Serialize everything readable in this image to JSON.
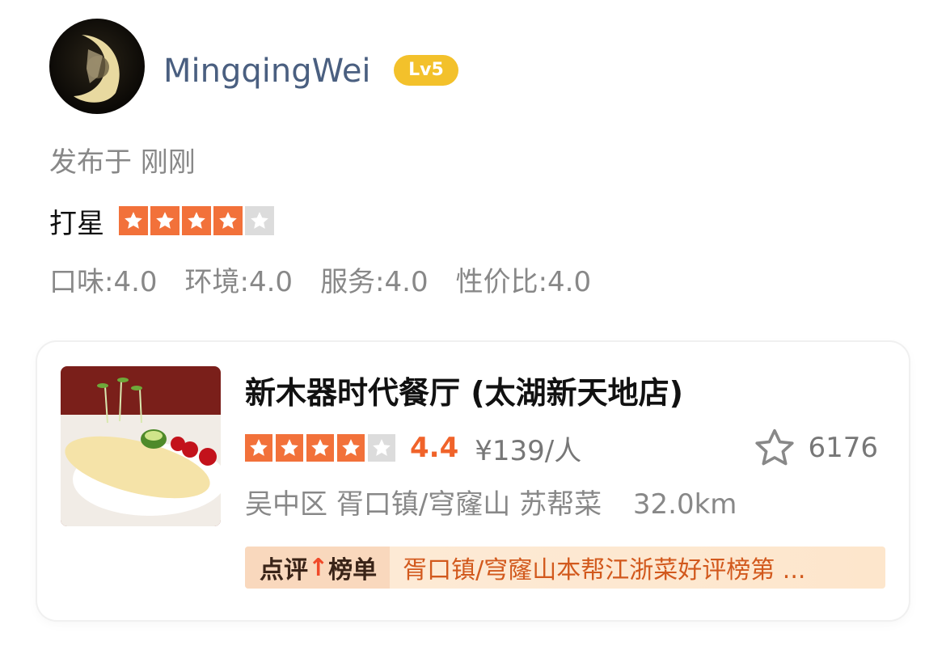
{
  "user": {
    "name": "MingqingWei",
    "level": "Lv5",
    "posted": "发布于 刚刚"
  },
  "review": {
    "rating_label": "打星",
    "stars_filled": 4,
    "stars_total": 5,
    "sub_scores": [
      "口味:4.0",
      "环境:4.0",
      "服务:4.0",
      "性价比:4.0"
    ]
  },
  "shop": {
    "name": "新木器时代餐厅 (太湖新天地店)",
    "stars_filled": 4,
    "stars_total": 5,
    "score": "4.4",
    "price": "¥139/人",
    "favorites": "6176",
    "district": "吴中区",
    "area": "胥口镇/穹窿山",
    "cuisine": "苏帮菜",
    "distance": "32.0km",
    "rank_badge_prefix": "点评",
    "rank_badge_arrow": "↑",
    "rank_badge_suffix": "榜单",
    "rank_text": "胥口镇/穹窿山本帮江浙菜好评榜第 ..."
  },
  "colors": {
    "star_filled": "#f2713a",
    "star_empty": "#dcdcdc",
    "level_badge": "#f3c12b",
    "username": "#4a5f80",
    "score": "#f0632a"
  },
  "icons": {
    "star": "star-icon",
    "favorite": "star-outline-icon",
    "avatar": "crescent-moon-figure"
  }
}
